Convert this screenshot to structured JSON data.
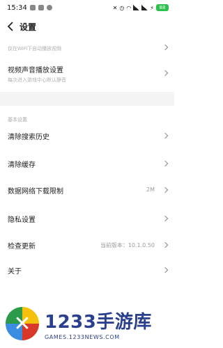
{
  "status_bar": {
    "time": "15:34",
    "battery": "88"
  },
  "header": {
    "title": "设置"
  },
  "top_partial": {
    "subtitle": "仅在WiFi下自动播放视频"
  },
  "video_sound": {
    "label": "视频声音播放设置",
    "subtitle": "每次进入游戏中心默认静音"
  },
  "basic_section": {
    "label": "基本设置",
    "items": [
      {
        "label": "清除搜索历史",
        "value": ""
      },
      {
        "label": "清除缓存",
        "value": ""
      },
      {
        "label": "数据网络下载限制",
        "value": "2M"
      },
      {
        "label": "隐私设置",
        "value": ""
      },
      {
        "label": "检查更新",
        "value": "当前版本：10.1.0.50"
      },
      {
        "label": "关于",
        "value": ""
      }
    ]
  },
  "watermark": {
    "brand": "1233手游库",
    "url": "GAMES.1233NEWS.COM"
  }
}
